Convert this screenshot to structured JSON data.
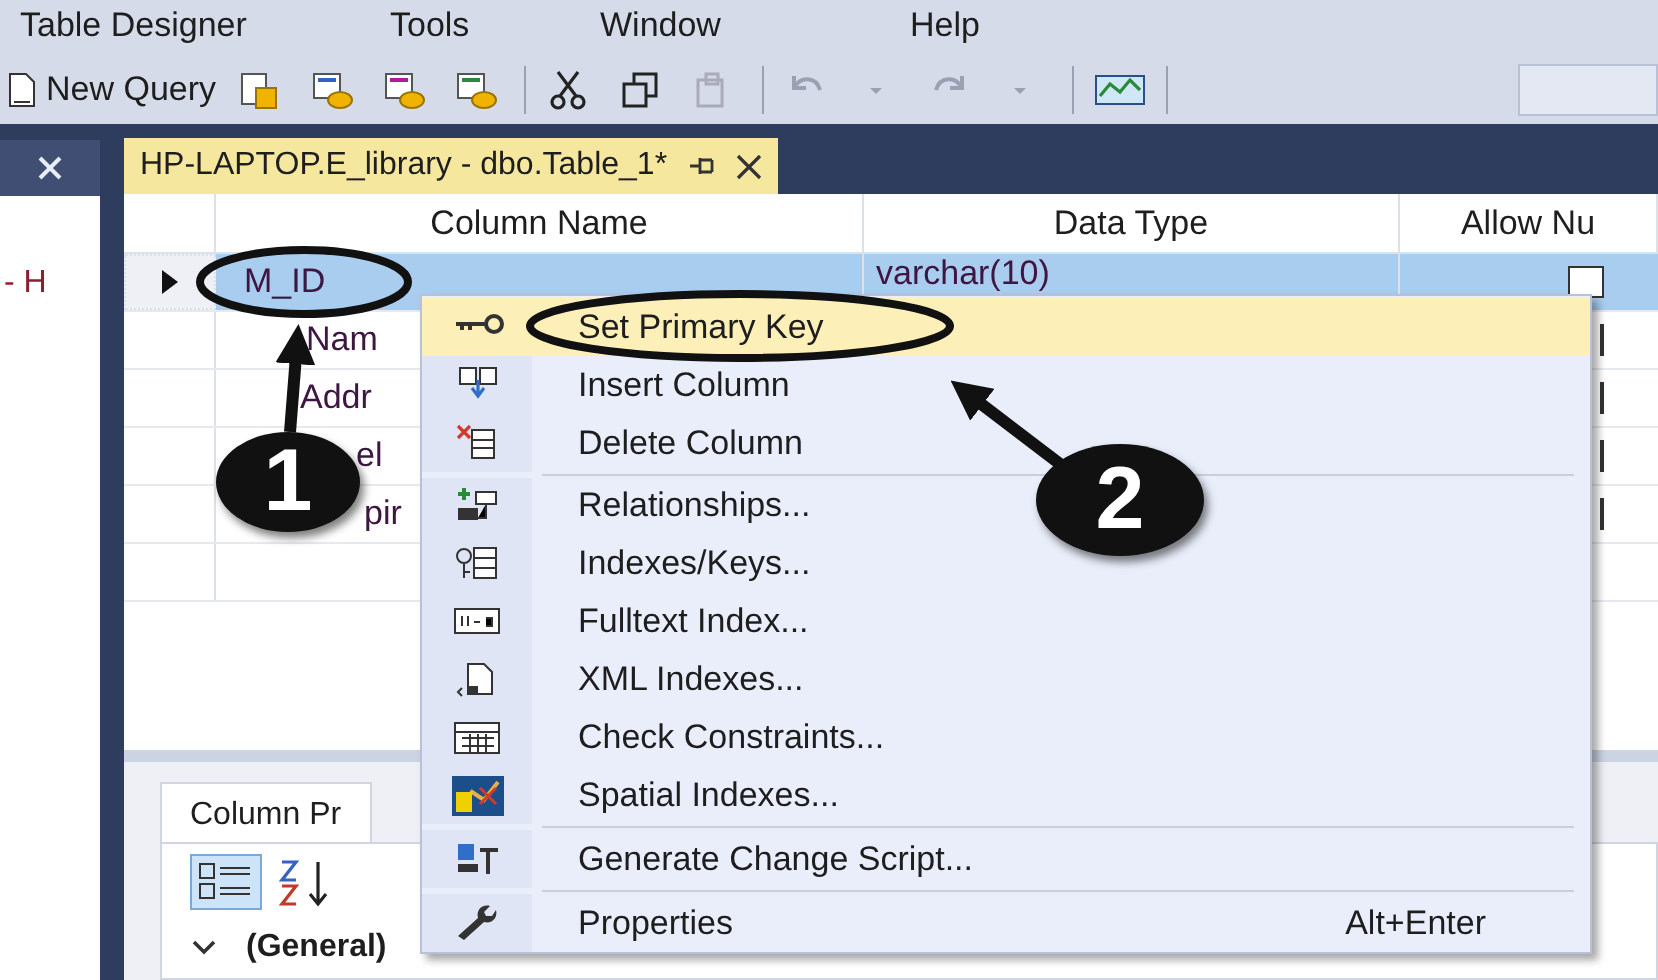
{
  "menu_bar": [
    "Table Designer",
    "Tools",
    "Window",
    "Help"
  ],
  "toolbar": {
    "new_query": "New Query"
  },
  "side_panel": {
    "text": "- H"
  },
  "document_tab": {
    "title": "HP-LAPTOP.E_library - dbo.Table_1*"
  },
  "grid": {
    "columns": [
      "Column Name",
      "Data Type",
      "Allow Nu"
    ],
    "rows": [
      {
        "column_name": "M_ID",
        "data_type": "varchar(10)",
        "allow_nulls": false,
        "selected": true
      },
      {
        "column_name": "Nam",
        "selected": false
      },
      {
        "column_name": "Addr",
        "selected": false
      },
      {
        "column_name": "el",
        "selected": false
      },
      {
        "column_name": "pir",
        "selected": false
      }
    ]
  },
  "context_menu": {
    "items": [
      {
        "kind": "item",
        "label": "Set Primary Key",
        "highlighted": true
      },
      {
        "kind": "item",
        "label": "Insert Column",
        "highlighted": false
      },
      {
        "kind": "item",
        "label": "Delete Column",
        "highlighted": false
      },
      {
        "kind": "separator"
      },
      {
        "kind": "item",
        "label": "Relationships...",
        "highlighted": false
      },
      {
        "kind": "item",
        "label": "Indexes/Keys...",
        "highlighted": false
      },
      {
        "kind": "item",
        "label": "Fulltext Index...",
        "highlighted": false
      },
      {
        "kind": "item",
        "label": "XML Indexes...",
        "highlighted": false
      },
      {
        "kind": "item",
        "label": "Check Constraints...",
        "highlighted": false
      },
      {
        "kind": "item",
        "label": "Spatial Indexes...",
        "highlighted": false
      },
      {
        "kind": "separator"
      },
      {
        "kind": "item",
        "label": "Generate Change Script...",
        "highlighted": false
      },
      {
        "kind": "separator"
      },
      {
        "kind": "item",
        "label": "Properties",
        "shortcut": "Alt+Enter",
        "highlighted": false
      }
    ]
  },
  "properties_panel": {
    "tab": "Column Pr",
    "category": "(General)"
  },
  "annotations": [
    {
      "number": "1"
    },
    {
      "number": "2"
    }
  ]
}
